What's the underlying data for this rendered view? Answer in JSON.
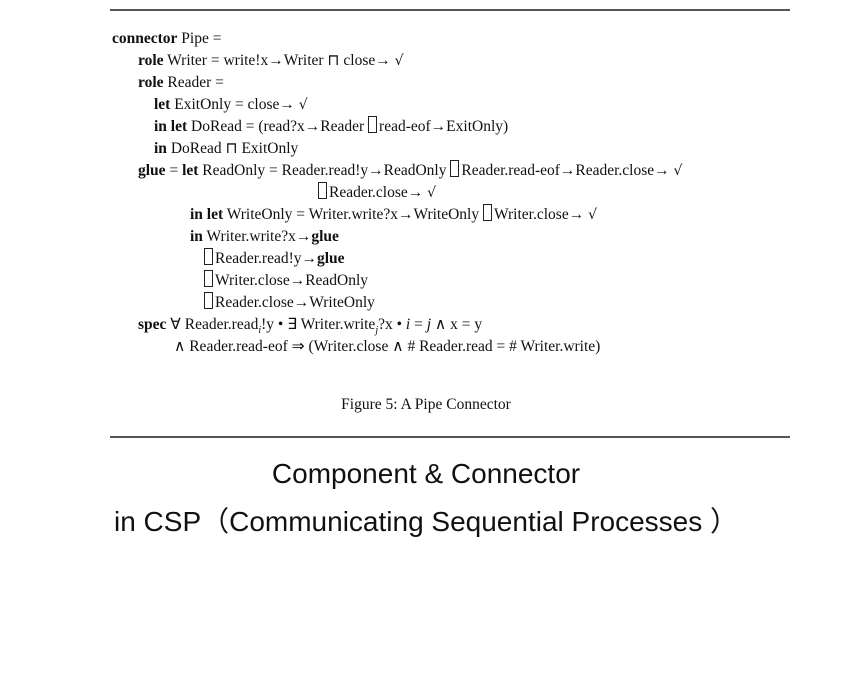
{
  "lines": {
    "l1": {
      "kw": "connector",
      "rest": " Pipe ="
    },
    "l2": {
      "kw": "role",
      "rest": " Writer = write!x→Writer ⊓ close→ "
    },
    "l3": {
      "kw": "role",
      "rest": " Reader ="
    },
    "l4": {
      "kw": "let",
      "rest": " ExitOnly = close→ "
    },
    "l5": {
      "kw": "in let",
      "rest": " DoRead = (read?x→Reader ",
      "rest2": "read-eof→ExitOnly)"
    },
    "l6": {
      "kw": "in",
      "rest": " DoRead ⊓ ExitOnly"
    },
    "l7": {
      "kw": "glue",
      "eq": " = ",
      "kw2": "let",
      "rest": " ReadOnly = Reader.read!y→ReadOnly ",
      "rest2": "Reader.read-eof→Reader.close→ "
    },
    "l8": {
      "rest": "Reader.close→ "
    },
    "l9": {
      "kw": "in let",
      "rest": " WriteOnly = Writer.write?x→WriteOnly ",
      "rest2": "Writer.close→ "
    },
    "l10": {
      "kw": "in",
      "rest": " Writer.write?x→",
      "kw2": "glue"
    },
    "l11": {
      "rest": "Reader.read!y→",
      "kw2": "glue"
    },
    "l12": {
      "rest": "Writer.close→ReadOnly"
    },
    "l13": {
      "rest": "Reader.close→WriteOnly"
    },
    "l14": {
      "kw": "spec",
      "a": " ∀ Reader.read",
      "sub_i": "i",
      "b": "!y • ∃ Writer.write",
      "sub_j": "j",
      "c": "?x • ",
      "d": " = ",
      "e": " ∧ x = y"
    },
    "l15": {
      "rest": "∧ Reader.read-eof ⇒ (Writer.close ∧ # Reader.read = # Writer.write)"
    }
  },
  "vars": {
    "i": "i",
    "j": "j"
  },
  "check_mark": "√",
  "caption": "Figure 5: A Pipe Connector",
  "title_line1": "Component & Connector",
  "title_line2": "in CSP（Communicating Sequential Processes ）"
}
